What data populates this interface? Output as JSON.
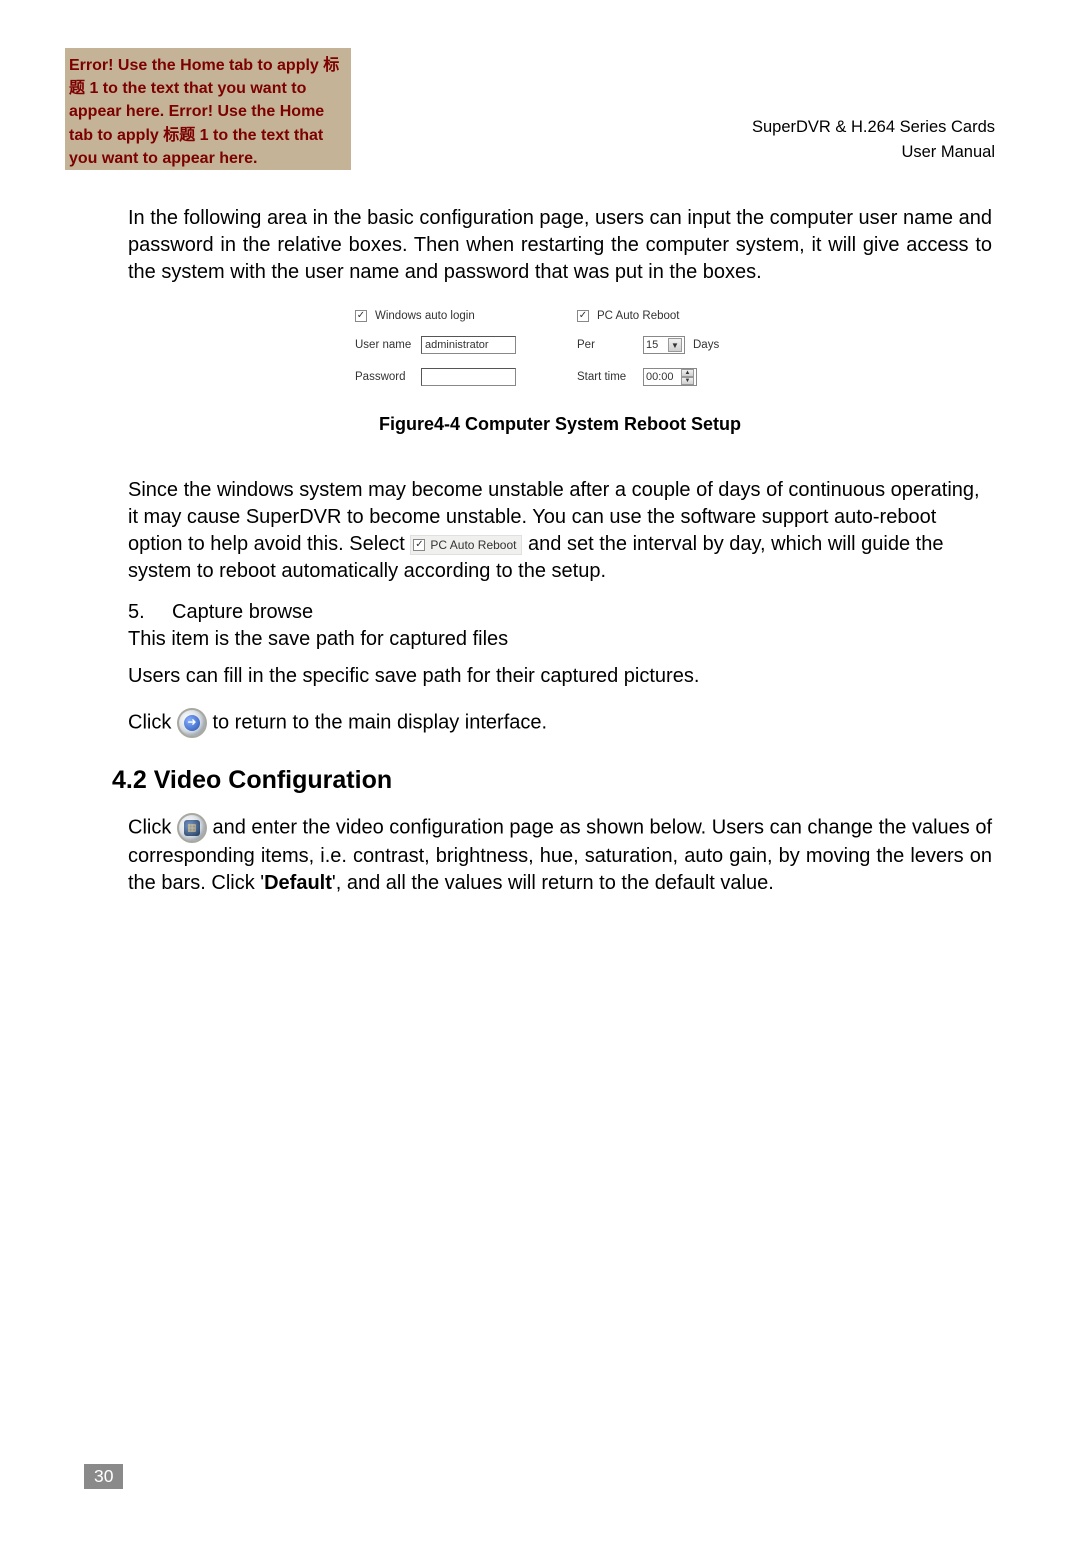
{
  "header": {
    "left_text": "Error! Use the Home tab to apply 标题 1 to the text that you want to appear here. Error! Use the Home tab to apply 标题 1 to the text that you want to appear here.",
    "right_line1": "SuperDVR & H.264 Series Cards",
    "right_line2": "User Manual"
  },
  "para1": "In the following area in the basic configuration page, users can input the computer user name and password in the relative boxes. Then when restarting the computer system, it will give access to the system with the user name and password that was put in the boxes.",
  "figure": {
    "left": {
      "checkbox_label": "Windows auto login",
      "username_label": "User name",
      "username_value": "administrator",
      "password_label": "Password",
      "password_value": ""
    },
    "right": {
      "checkbox_label": "PC Auto Reboot",
      "per_label": "Per",
      "per_value": "15",
      "days_label": "Days",
      "starttime_label": "Start time",
      "starttime_value": "00:00"
    },
    "caption": "Figure4-4  Computer System Reboot Setup"
  },
  "para2_part1": "Since the windows system may become unstable after a couple of days of continuous operating, it may cause SuperDVR to become unstable. You can use the software support auto-reboot option to help avoid this. Select",
  "para2_inline_cb": "PC Auto Reboot",
  "para2_part2": " and set the interval by day, which will guide the system to reboot automatically according to the setup.",
  "list_num": "5.",
  "list_text": "Capture browse",
  "para3": "This item is the save path for captured files",
  "para4": "Users can fill in the specific save path for their captured pictures.",
  "para5_part1": "Click ",
  "para5_part2": " to return to the main display interface.",
  "section_heading": "4.2 Video Configuration",
  "para6_part1": "Click ",
  "para6_part2": " and enter the video configuration page as shown below. Users can change the values of corresponding items, i.e. contrast, brightness, hue, saturation, auto gain, by moving the levers on the bars. Click '",
  "para6_bold": "Default",
  "para6_part3": "', and all the values will return to the default value.",
  "page_number": "30",
  "checkmark": "✓",
  "down_triangle": "▼",
  "up_triangle": "▲"
}
